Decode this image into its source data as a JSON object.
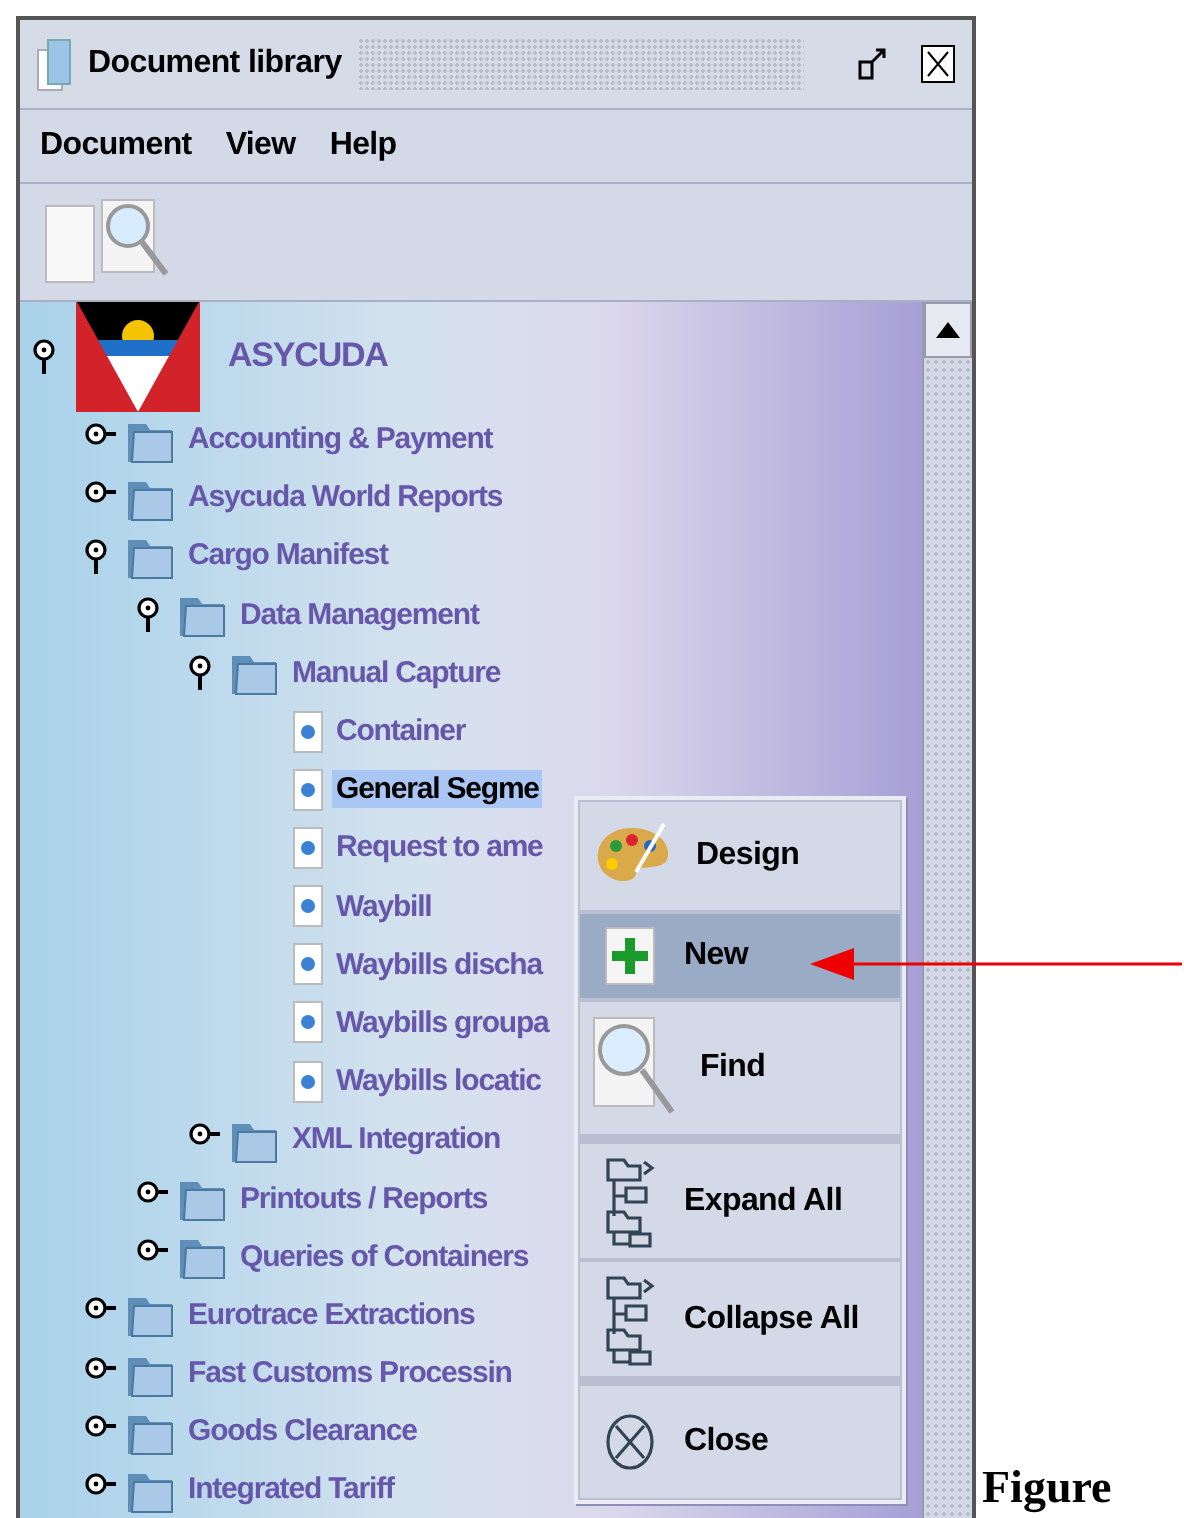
{
  "window": {
    "title": "Document library"
  },
  "menu": [
    "Document",
    "View",
    "Help"
  ],
  "toolbar": [
    {
      "kind": "new"
    },
    {
      "kind": "find"
    }
  ],
  "tree": [
    {
      "label": "ASYCUDA",
      "kind": "root",
      "expanded": true,
      "children": [
        {
          "label": "Accounting & Payment",
          "kind": "folder",
          "expanded": false
        },
        {
          "label": "Asycuda World Reports",
          "kind": "folder",
          "expanded": false
        },
        {
          "label": "Cargo Manifest",
          "kind": "folder",
          "expanded": true,
          "children": [
            {
              "label": "Data Management",
              "kind": "folder",
              "expanded": true,
              "children": [
                {
                  "label": "Manual Capture",
                  "kind": "folder",
                  "expanded": true,
                  "children": [
                    {
                      "label": "Container",
                      "kind": "document",
                      "selected": false
                    },
                    {
                      "label": "General Segme",
                      "kind": "document",
                      "selected": true
                    },
                    {
                      "label": "Request to ame",
                      "kind": "document",
                      "selected": false
                    },
                    {
                      "label": "Waybill",
                      "kind": "document",
                      "selected": false
                    },
                    {
                      "label": "Waybills discha",
                      "kind": "document",
                      "selected": false
                    },
                    {
                      "label": "Waybills groupa",
                      "kind": "document",
                      "selected": false
                    },
                    {
                      "label": "Waybills locatic",
                      "kind": "document",
                      "selected": false
                    }
                  ]
                },
                {
                  "label": "XML Integration",
                  "kind": "folder",
                  "expanded": false
                }
              ]
            },
            {
              "label": "Printouts / Reports",
              "kind": "folder",
              "expanded": false
            },
            {
              "label": "Queries of Containers",
              "kind": "folder",
              "expanded": false
            }
          ]
        },
        {
          "label": "Eurotrace Extractions",
          "kind": "folder",
          "expanded": false
        },
        {
          "label": "Fast Customs Processin",
          "kind": "folder",
          "expanded": false
        },
        {
          "label": "Goods Clearance",
          "kind": "folder",
          "expanded": false
        },
        {
          "label": "Integrated Tariff",
          "kind": "folder",
          "expanded": false
        }
      ]
    }
  ],
  "context_menu": [
    [
      {
        "label": "Design",
        "kind": "design",
        "selected": false
      },
      {
        "label": "New",
        "kind": "new",
        "selected": true
      },
      {
        "label": "Find",
        "kind": "find",
        "selected": false
      }
    ],
    [
      {
        "label": "Expand All",
        "kind": "expand",
        "selected": false
      },
      {
        "label": "Collapse All",
        "kind": "collapse",
        "selected": false
      }
    ],
    [
      {
        "label": "Close",
        "kind": "close",
        "selected": false
      }
    ]
  ],
  "caption": "Figure"
}
